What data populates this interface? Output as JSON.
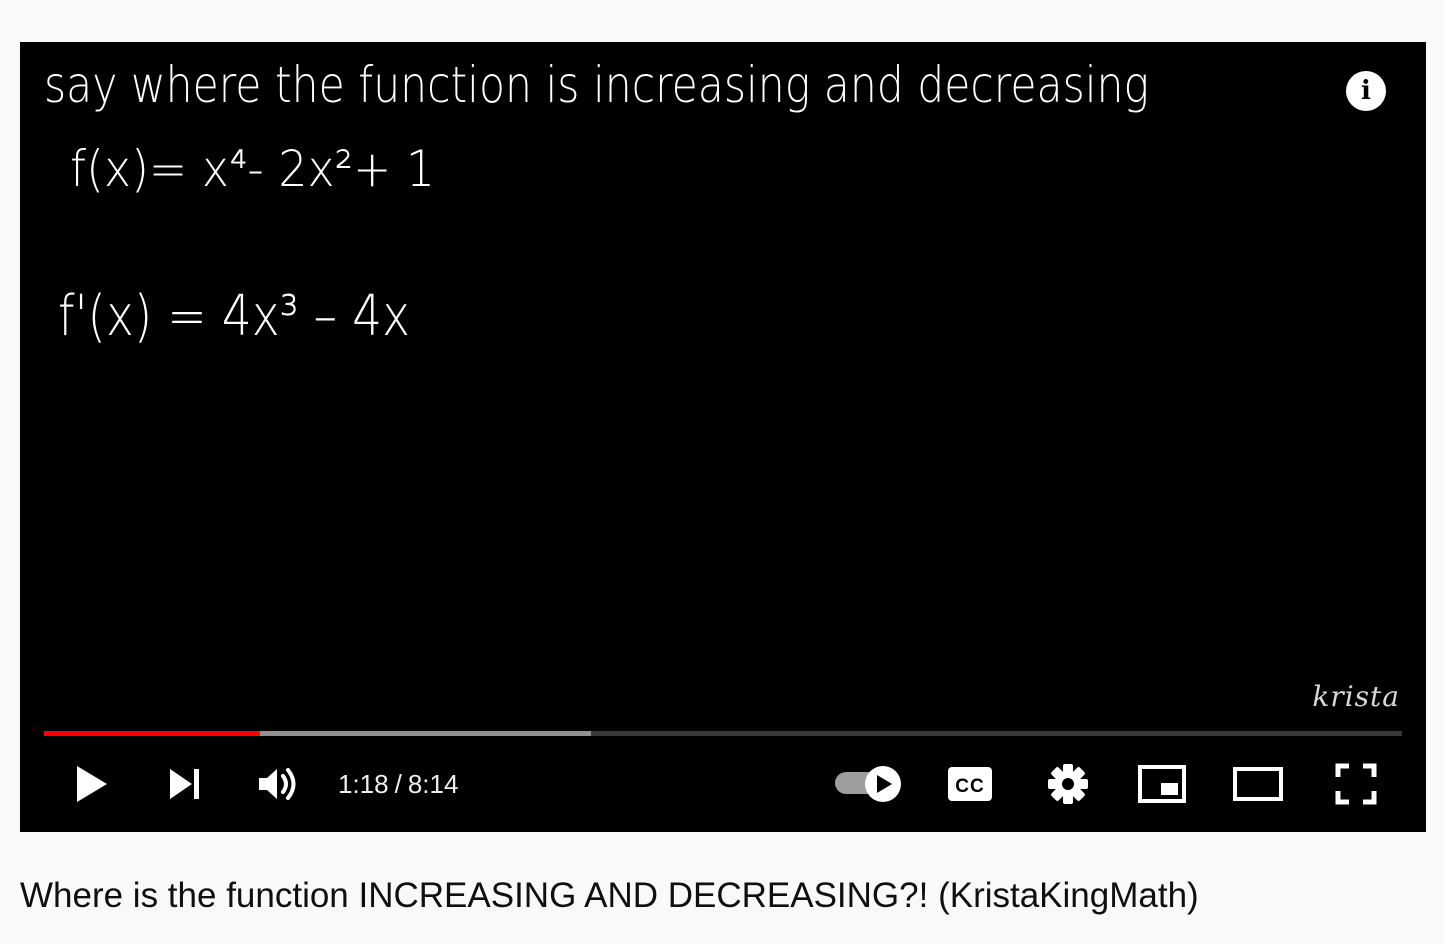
{
  "video": {
    "board_text": {
      "line1": "say where the function is increasing and decreasing",
      "line2": "f(x)= x⁴- 2x²+ 1",
      "line3": "f'(x) = 4x³ – 4x"
    },
    "info_icon": "info-icon",
    "watermark": "krista"
  },
  "player": {
    "progress": {
      "played_fraction": 0.159,
      "buffered_fraction": 0.403,
      "played_color": "#ff0000"
    },
    "current_time": "1:18",
    "separator": "/",
    "duration": "8:14",
    "icons": {
      "play": "play-icon",
      "next": "next-icon",
      "volume": "volume-icon",
      "autoplay": "autoplay-toggle",
      "captions": "captions-icon",
      "settings": "gear-icon",
      "miniplayer": "miniplayer-icon",
      "theater": "theater-mode-icon",
      "fullscreen": "fullscreen-icon"
    },
    "captions_label": "CC"
  },
  "title": "Where is the function INCREASING AND DECREASING?! (KristaKingMath)"
}
